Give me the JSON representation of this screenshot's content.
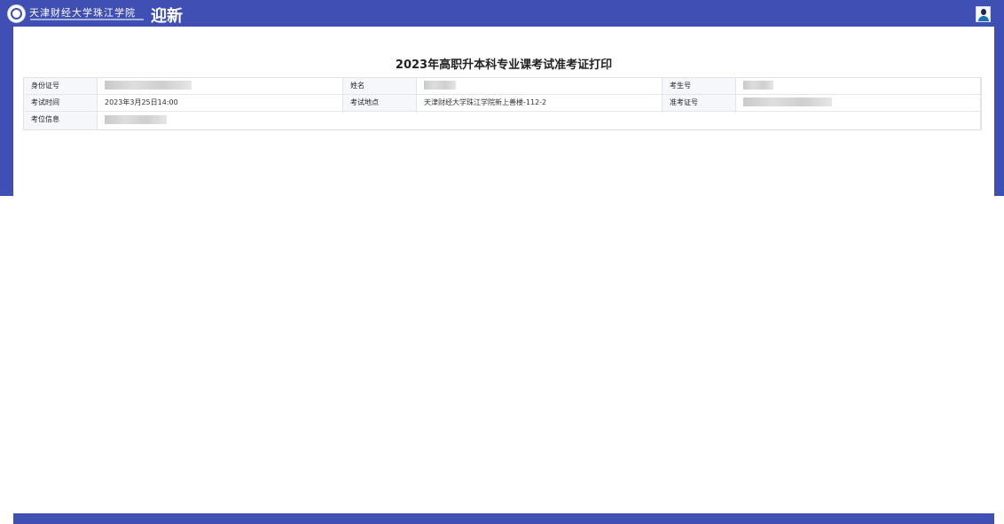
{
  "header": {
    "school_name": "天津财经大学珠江学院",
    "app_title": "迎新",
    "logo_icon": "school-seal-icon",
    "avatar_icon": "user-avatar-icon"
  },
  "colors": {
    "brand": "#3f4fb4",
    "table_bg": "#f6f7fb"
  },
  "document": {
    "title": "2023年高职升本科专业课考试准考证打印",
    "fields": {
      "id_number_label": "身份证号",
      "name_label": "姓名",
      "candidate_no_label": "考生号",
      "exam_time_label": "考试时间",
      "exam_time_value": "2023年3月25日14:00",
      "exam_location_label": "考试地点",
      "exam_location_value": "天津财经大学珠江学院新上善楼-112-2",
      "admission_no_label": "准考证号",
      "seat_info_label": "考位信息"
    }
  }
}
